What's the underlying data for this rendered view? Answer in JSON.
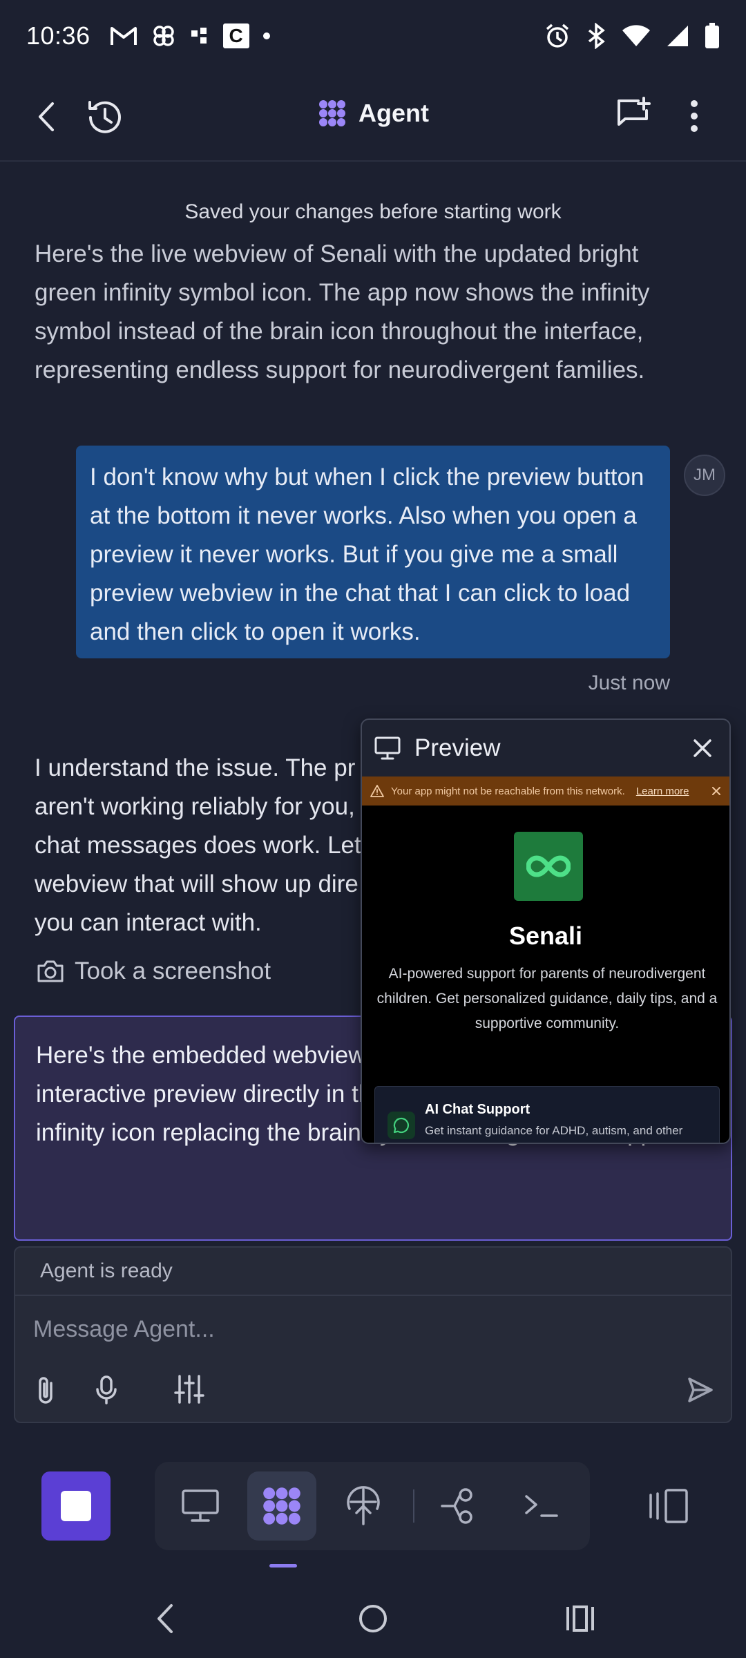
{
  "status_bar": {
    "time": "10:36",
    "icons_left": [
      "gmail-icon",
      "pinwheel-icon",
      "dots-icon",
      "c-app-icon",
      "dot-icon"
    ],
    "c_label": "C",
    "icons_right": [
      "alarm-icon",
      "bluetooth-icon",
      "wifi-icon",
      "signal-icon",
      "battery-icon"
    ]
  },
  "topbar": {
    "title": "Agent"
  },
  "chat": {
    "saved_note": "Saved your changes before starting work",
    "agent_message_1": "Here's the live webview of Senali with the updated bright green infinity symbol icon. The app now shows the infinity symbol instead of the brain icon throughout the interface, representing endless support for neurodivergent families.",
    "user_message": "I don't know why but when I click the preview button at the bottom it never works. Also when you open a preview it never works. But if you give me a small preview webview in the chat that I can click to load and then click to open it works.",
    "user_avatar": "JM",
    "timestamp": "Just now",
    "agent_message_2": "I understand the issue. The pr aren't working reliably for you, chat messages does work. Let webview that will show up dire you can interact with.",
    "screenshot_label": "Took a screenshot",
    "agent_message_3": "Here's the embedded webview green infinity symbol. This sho interactive preview directly in the updated landing page with the infinity icon replacing the brain symbol throughout the app."
  },
  "composer": {
    "status": "Agent is ready",
    "placeholder": "Message Agent..."
  },
  "preview": {
    "title": "Preview",
    "warning": "Your app might not be reachable from this network.",
    "learn_more": "Learn more",
    "app_name": "Senali",
    "description": "AI-powered support for parents of neurodivergent children. Get personalized guidance, daily tips, and a supportive community.",
    "feature_title": "AI Chat Support",
    "feature_desc": "Get instant guidance for ADHD, autism, and other neurodivergent needs"
  },
  "colors": {
    "accent": "#5b3fd4",
    "user_bubble": "#1b4a85",
    "logo_green": "#1e7b3c",
    "warning_bg": "#6e3a0c"
  }
}
